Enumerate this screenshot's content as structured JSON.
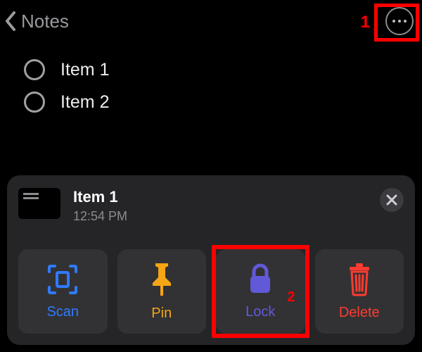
{
  "header": {
    "back_label": "Notes"
  },
  "callouts": {
    "one": "1",
    "two": "2"
  },
  "list": {
    "items": [
      {
        "label": "Item 1"
      },
      {
        "label": "Item 2"
      }
    ]
  },
  "sheet": {
    "title": "Item 1",
    "timestamp": "12:54 PM",
    "actions": {
      "scan": {
        "label": "Scan"
      },
      "pin": {
        "label": "Pin"
      },
      "lock": {
        "label": "Lock"
      },
      "delete": {
        "label": "Delete"
      }
    }
  }
}
